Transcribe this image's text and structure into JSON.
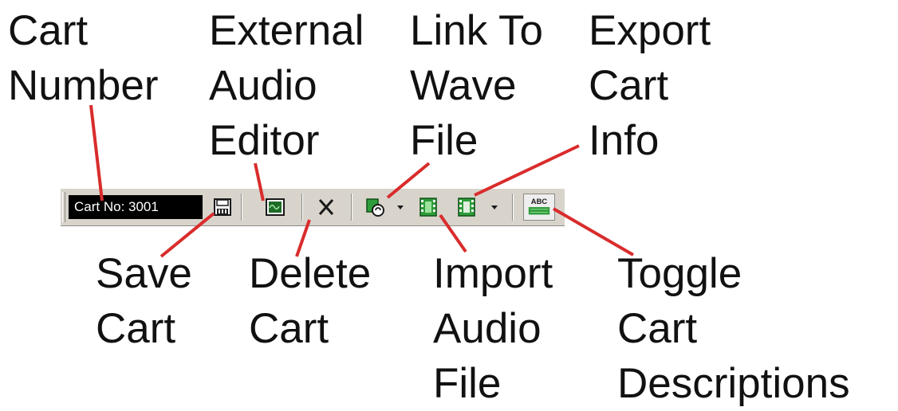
{
  "callouts": {
    "cart_number": "Cart\nNumber",
    "external_audio_editor": "External\nAudio\nEditor",
    "link_to_wave_file": "Link To\nWave\nFile",
    "export_cart_info": "Export\nCart\nInfo",
    "save_cart": "Save\nCart",
    "delete_cart": "Delete\nCart",
    "import_audio_file": "Import\nAudio\nFile",
    "toggle_cart_descriptions": "Toggle\nCart\nDescriptions"
  },
  "toolbar": {
    "cart_number_text": "Cart No: 3001",
    "icons": [
      "floppy-disk-icon",
      "audio-editor-icon",
      "delete-x-icon",
      "link-wave-icon",
      "import-audio-icon",
      "export-info-icon",
      "abc-toggle-icon"
    ],
    "toggle_icon_text": "ABC"
  },
  "colors": {
    "pointer": "#d92c2c",
    "toolbar_bg": "#d8d4cc",
    "cart_number_bg": "#000000",
    "cart_number_fg": "#ffffff",
    "icon_green": "#2e9c3a"
  }
}
